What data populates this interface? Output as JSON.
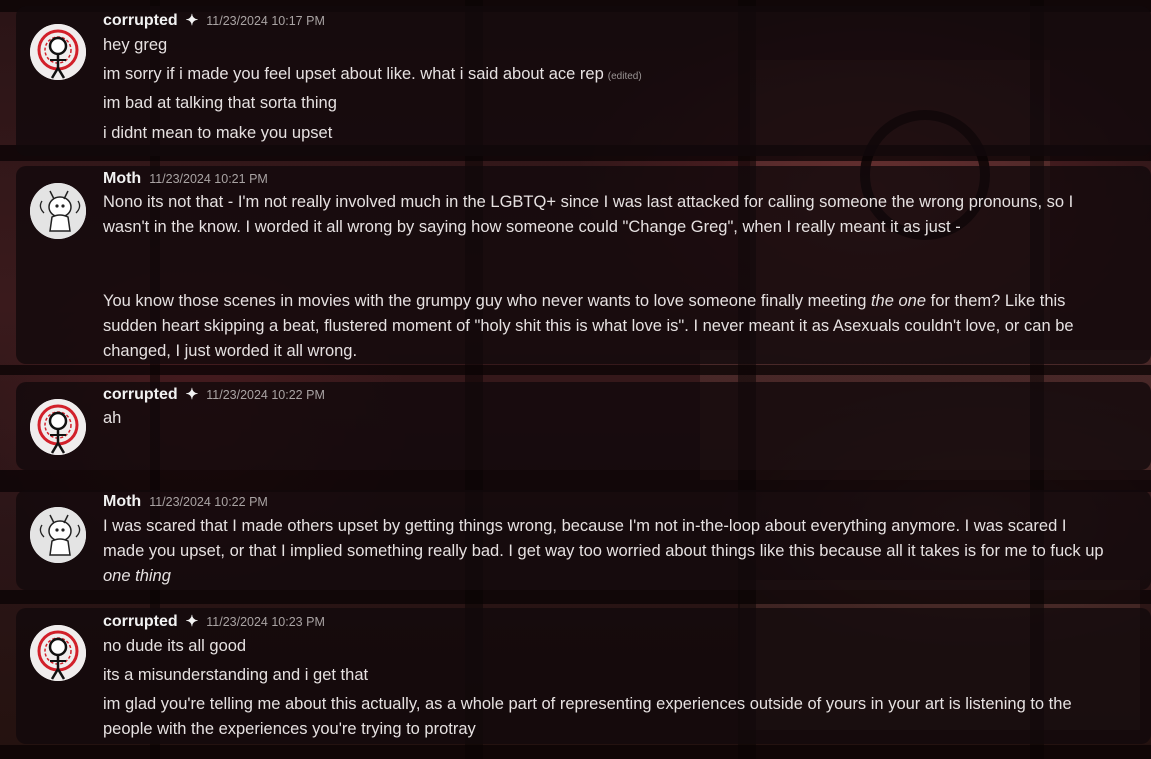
{
  "messages": [
    {
      "author": "corrupted",
      "author_badge": "✦",
      "timestamp": "11/23/2024 10:17 PM",
      "lines": [
        {
          "text": "hey greg"
        },
        {
          "text": "im sorry if i made you feel upset about like. what i said about ace rep",
          "edited": "(edited)"
        },
        {
          "text": "im bad at talking that sorta thing"
        },
        {
          "text": "i didnt mean to make you upset"
        }
      ]
    },
    {
      "author": "Moth",
      "timestamp": "11/23/2024 10:21 PM",
      "p1": "Nono its not that - I'm not really involved much in the LGBTQ+ since I was last attacked for calling someone the wrong pronouns, so I wasn't in the know. I worded it all wrong by saying how someone could \"Change Greg\", when I really meant it as just -",
      "p2_before": "You know those scenes in movies with the grumpy guy who never wants to love someone finally meeting ",
      "p2_em": "the one",
      "p2_after": " for them? Like this sudden heart skipping a beat, flustered moment of \"holy shit this is what love is\". I never meant it as Asexuals couldn't love, or can be changed, I just worded it all wrong."
    },
    {
      "author": "corrupted",
      "author_badge": "✦",
      "timestamp": "11/23/2024 10:22 PM",
      "lines": [
        {
          "text": "ah"
        }
      ]
    },
    {
      "author": "Moth",
      "timestamp": "11/23/2024 10:22 PM",
      "p1_before": "I was scared that I made others upset by getting things wrong, because I'm not in-the-loop about everything anymore. I was scared I made you upset, or that I implied something really bad. I get way too worried about things like this because all it takes is for me to fuck up ",
      "p1_em": "one thing"
    },
    {
      "author": "corrupted",
      "author_badge": "✦",
      "timestamp": "11/23/2024 10:23 PM",
      "lines": [
        {
          "text": "no dude its all good"
        },
        {
          "text": "its a misunderstanding and i get that"
        },
        {
          "text": "im glad you're telling me about this actually, as a whole part of representing experiences outside of yours in your art is listening to the people with the experiences you're trying to protray"
        }
      ]
    }
  ],
  "colors": {
    "message_bg": "#120909",
    "author": "#f2f2f2",
    "text": "#e6e1e1",
    "timestamp": "#a9a3a3",
    "avatar_red": "#d2202a"
  },
  "icons": {
    "corrupted_avatar": "red-sigil-stickfigure-avatar",
    "moth_avatar": "moth-sketch-avatar",
    "badge": "sparkle-icon"
  }
}
